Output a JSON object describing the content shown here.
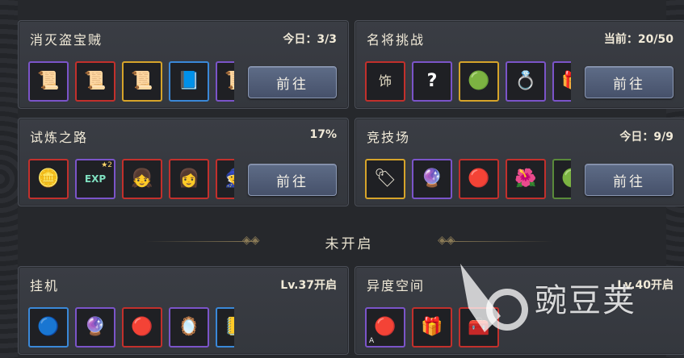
{
  "divider": {
    "label": "未开启"
  },
  "panels": [
    {
      "title": "消灭盗宝贼",
      "status": "今日：3/3",
      "button": "前往",
      "items": [
        {
          "icon": "purple-scroll-icon",
          "glyph": "📜",
          "rarity": "purple"
        },
        {
          "icon": "red-scroll-icon",
          "glyph": "📜",
          "rarity": "red"
        },
        {
          "icon": "gold-scroll-icon",
          "glyph": "📜",
          "rarity": "gold"
        },
        {
          "icon": "blue-scroll-icon",
          "glyph": "📘",
          "rarity": "blue"
        },
        {
          "icon": "purple-scroll-icon",
          "glyph": "📜",
          "rarity": "purple"
        }
      ]
    },
    {
      "title": "名将挑战",
      "status": "当前：20/50",
      "button": "前往",
      "items": [
        {
          "icon": "ornament-badge-icon",
          "glyph": "饰",
          "rarity": "red"
        },
        {
          "icon": "mystery-question-icon",
          "glyph": "?",
          "rarity": "purple"
        },
        {
          "icon": "jade-pendant-icon",
          "glyph": "🟢",
          "rarity": "gold"
        },
        {
          "icon": "silver-ring-icon",
          "glyph": "💍",
          "rarity": "purple"
        },
        {
          "icon": "treasure-chest-icon",
          "glyph": "🎁",
          "rarity": "purple"
        }
      ]
    },
    {
      "title": "试炼之路",
      "status": "17%",
      "button": "前往",
      "items": [
        {
          "icon": "gold-coin-icon",
          "glyph": "🪙",
          "rarity": "red"
        },
        {
          "icon": "exp-book-icon",
          "glyph": "EXP",
          "rarity": "purple",
          "badge": "★2"
        },
        {
          "icon": "hero-portrait-icon",
          "glyph": "👧",
          "rarity": "red"
        },
        {
          "icon": "hero-portrait-icon",
          "glyph": "👩",
          "rarity": "red"
        },
        {
          "icon": "hero-portrait-icon",
          "glyph": "🧙",
          "rarity": "red"
        }
      ]
    },
    {
      "title": "竞技场",
      "status": "今日：9/9",
      "button": "前往",
      "items": [
        {
          "icon": "scroll-tag-icon",
          "glyph": "🏷",
          "rarity": "gold"
        },
        {
          "icon": "purple-orb-icon",
          "glyph": "🔮",
          "rarity": "purple"
        },
        {
          "icon": "red-orb-icon",
          "glyph": "🔴",
          "rarity": "red"
        },
        {
          "icon": "red-flower-icon",
          "glyph": "🌺",
          "rarity": "red"
        },
        {
          "icon": "green-orb-icon",
          "glyph": "🟢",
          "rarity": "green"
        }
      ]
    },
    {
      "title": "挂机",
      "status": "Lv.37开启",
      "items": [
        {
          "icon": "blue-orb-icon",
          "glyph": "🔵",
          "rarity": "blue"
        },
        {
          "icon": "purple-orb-icon",
          "glyph": "🔮",
          "rarity": "purple"
        },
        {
          "icon": "red-orb-icon",
          "glyph": "🔴",
          "rarity": "red"
        },
        {
          "icon": "mystery-mirror-icon",
          "glyph": "🪞",
          "rarity": "purple"
        },
        {
          "icon": "gold-book-icon",
          "glyph": "📒",
          "rarity": "blue"
        }
      ]
    },
    {
      "title": "异度空间",
      "status": "Lv.40开启",
      "items": [
        {
          "icon": "red-orb-stand-icon",
          "glyph": "🔴",
          "rarity": "purple",
          "corner": "A"
        },
        {
          "icon": "jade-chest-icon",
          "glyph": "🎁",
          "rarity": "red"
        },
        {
          "icon": "hero-chest-icon",
          "glyph": "🧰",
          "rarity": "red"
        }
      ]
    }
  ],
  "watermark": {
    "text": "豌豆荚"
  }
}
